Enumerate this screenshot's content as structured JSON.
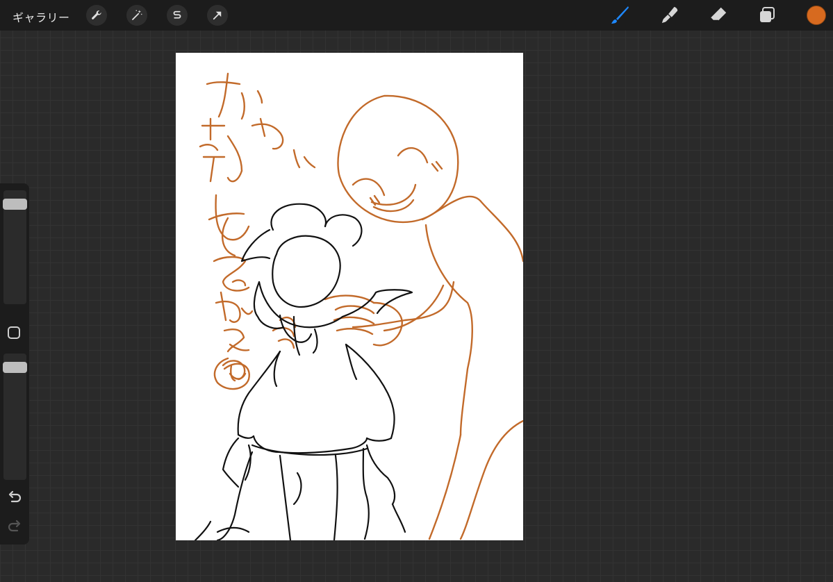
{
  "topbar": {
    "gallery_label": "ギャラリー",
    "left_tools": [
      "wrench-icon",
      "magic-wand-icon",
      "selection-s-icon",
      "transform-arrow-icon"
    ],
    "right_tools": [
      "brush-icon",
      "smudge-icon",
      "eraser-icon",
      "layers-icon"
    ],
    "active_tool": "brush-icon",
    "current_color": "#d76a1f"
  },
  "sidebar": {
    "brush_size_level": 0.92,
    "opacity_level": 0.93,
    "controls": [
      "modifier-square",
      "undo-icon",
      "redo-icon"
    ]
  },
  "colors": {
    "ink": "#111111",
    "sketch": "#c26a2a",
    "canvas": "#ffffff",
    "active_tool": "#1e88ff"
  }
}
